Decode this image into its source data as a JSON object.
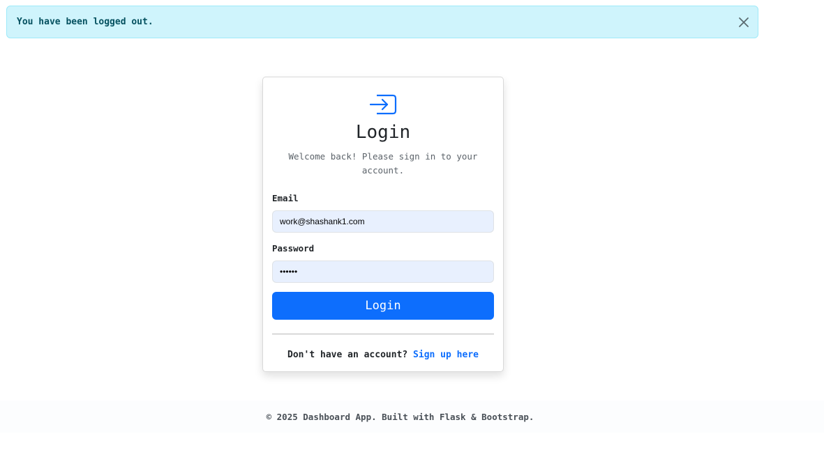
{
  "alert": {
    "message": "You have been logged out.",
    "close_icon": "close-icon",
    "color": "#cff4fc"
  },
  "login_card": {
    "icon": "login-arrow-icon",
    "title": "Login",
    "subtitle": "Welcome back! Please sign in to your account.",
    "email": {
      "label": "Email",
      "value": "work@shashank1.com"
    },
    "password": {
      "label": "Password",
      "value": "••••••"
    },
    "submit_label": "Login",
    "signup_prompt": "Don't have an account?",
    "signup_link": "Sign up here",
    "accent": "#0d6efd"
  },
  "footer": {
    "text": "© 2025 Dashboard App. Built with Flask & Bootstrap."
  }
}
